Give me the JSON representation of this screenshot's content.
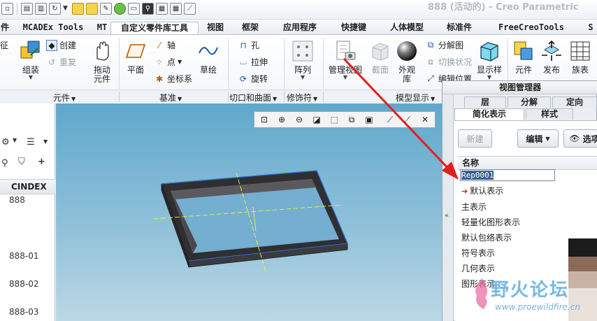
{
  "window": {
    "title": "888 (活动的) - Creo Parametric"
  },
  "ribbon_tabs": [
    {
      "label": "件"
    },
    {
      "label": "MCADEx Tools"
    },
    {
      "label": "MT"
    },
    {
      "label": "自定义零件库工具"
    },
    {
      "label": "视图"
    },
    {
      "label": "框架"
    },
    {
      "label": "应用程序"
    },
    {
      "label": "快捷键"
    },
    {
      "label": "人体模型"
    },
    {
      "label": "标准件"
    },
    {
      "label": "FreeCreoTools"
    },
    {
      "label": "S"
    }
  ],
  "ribbon": {
    "component": {
      "partial": "征",
      "create": "创建",
      "restore": "重复",
      "assemble": "组装",
      "drag_line1": "拖动",
      "drag_line2": "元件",
      "group": "元件"
    },
    "datum": {
      "plane": "平面",
      "axis": "轴",
      "point": "点",
      "csys": "坐标系",
      "sketch": "草绘",
      "group": "基准"
    },
    "cut_surface": {
      "hole": "孔",
      "extrude": "拉伸",
      "revolve": "旋转",
      "group": "切口和曲面"
    },
    "modifiers": {
      "pattern": "阵列",
      "group": "修饰符"
    },
    "model_display": {
      "manage_views": "管理视图",
      "section": "截面",
      "appearance_line1": "外观",
      "appearance_line2": "库",
      "explode": "分解图",
      "toggle_state": "切换状况",
      "edit_position": "编辑位置",
      "display_style": "显示样",
      "group": "模型显示"
    },
    "extra": {
      "element": "元件",
      "publish": "发布",
      "family_table": "族表"
    }
  },
  "model_tree": {
    "column_header": "CINDEX",
    "rows": [
      "888",
      "888-01",
      "888-02",
      "888-03"
    ]
  },
  "view_manager": {
    "title": "视图管理器",
    "tabs_row1": [
      "层",
      "分解",
      "定向"
    ],
    "tabs_row2": [
      "简化表示",
      "样式"
    ],
    "buttons": {
      "new": "新建",
      "edit": "编辑",
      "options": "选项"
    },
    "list_header": "名称",
    "editing_value": "Rep0001",
    "items": [
      "默认表示",
      "主表示",
      "轻量化图形表示",
      "默认包络表示",
      "符号表示",
      "几何表示",
      "图形表示"
    ]
  },
  "watermark": {
    "text": "野火论坛",
    "url": "www.proewildfire.cn"
  },
  "colors": {
    "accent_red": "#e02020",
    "viewport_top": "#5fa8cc",
    "viewport_bottom": "#bcd8e6",
    "selection_blue": "#3a5f93",
    "watermark": "#5aaadc"
  }
}
